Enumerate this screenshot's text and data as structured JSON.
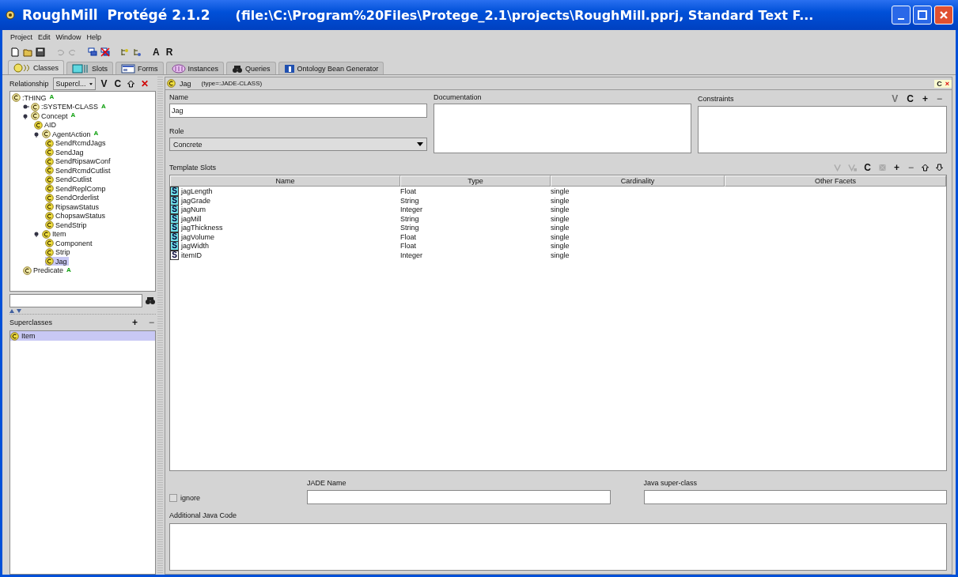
{
  "window": {
    "title": "RoughMill  Protégé 2.1.2",
    "subtitle": "(file:\\C:\\Program%20Files\\Protege_2.1\\projects\\RoughMill.pprj, Standard Text F..."
  },
  "menu": [
    "Project",
    "Edit",
    "Window",
    "Help"
  ],
  "toolbar_text": [
    "A",
    "R"
  ],
  "tabs": [
    {
      "label": "Classes",
      "selected": true
    },
    {
      "label": "Slots",
      "selected": false
    },
    {
      "label": "Forms",
      "selected": false
    },
    {
      "label": "Instances",
      "selected": false
    },
    {
      "label": "Queries",
      "selected": false
    },
    {
      "label": "Ontology Bean Generator",
      "selected": false
    }
  ],
  "relationship": {
    "label": "Relationship",
    "value": "Supercl...",
    "buttons": [
      "V",
      "C",
      "✕"
    ]
  },
  "tree": [
    {
      "label": ":THING",
      "badge": "A",
      "selected": false,
      "children": [
        {
          "label": ":SYSTEM-CLASS",
          "badge": "A",
          "selected": false,
          "expanded": false
        },
        {
          "label": "Concept",
          "badge": "A",
          "selected": false,
          "expanded": true,
          "children": [
            {
              "label": "AID",
              "selected": false
            },
            {
              "label": "AgentAction",
              "badge": "A",
              "selected": false,
              "expanded": true,
              "children": [
                {
                  "label": "SendRcmdJags",
                  "selected": false
                },
                {
                  "label": "SendJag",
                  "selected": false
                },
                {
                  "label": "SendRipsawConf",
                  "selected": false
                },
                {
                  "label": "SendRcmdCutlist",
                  "selected": false
                },
                {
                  "label": "SendCutlist",
                  "selected": false
                },
                {
                  "label": "SendReplComp",
                  "selected": false
                },
                {
                  "label": "SendOrderlist",
                  "selected": false
                },
                {
                  "label": "RipsawStatus",
                  "selected": false
                },
                {
                  "label": "ChopsawStatus",
                  "selected": false
                },
                {
                  "label": "SendStrip",
                  "selected": false
                }
              ]
            },
            {
              "label": "Item",
              "selected": false,
              "expanded": true,
              "children": [
                {
                  "label": "Component",
                  "selected": false
                },
                {
                  "label": "Strip",
                  "selected": false
                },
                {
                  "label": "Jag",
                  "selected": true
                }
              ]
            }
          ]
        },
        {
          "label": "Predicate",
          "badge": "A",
          "selected": false
        }
      ]
    }
  ],
  "superclasses": {
    "title": "Superclasses",
    "buttons": [
      "+",
      "−"
    ],
    "items": [
      {
        "label": "Item",
        "selected": true
      }
    ]
  },
  "header": {
    "class_name": "Jag",
    "type": "(type=:JADE-CLASS)",
    "buttons": [
      "C",
      "×"
    ]
  },
  "form": {
    "name_label": "Name",
    "name_value": "Jag",
    "role_label": "Role",
    "role_value": "Concrete",
    "documentation_label": "Documentation",
    "constraints_label": "Constraints",
    "constraint_buttons": [
      {
        "label": "V",
        "disabled": true
      },
      {
        "label": "C",
        "disabled": false
      },
      {
        "label": "+",
        "disabled": false
      },
      {
        "label": "−",
        "disabled": true
      }
    ]
  },
  "template_slots": {
    "title": "Template Slots",
    "buttons": [
      {
        "label": "C",
        "disabled": false
      },
      {
        "label": "+",
        "disabled": false
      },
      {
        "label": "−",
        "disabled": true
      }
    ],
    "columns": [
      "Name",
      "Type",
      "Cardinality",
      "Other Facets"
    ],
    "rows": [
      {
        "icon": "S",
        "name": "jagLength",
        "type": "Float",
        "cardinality": "single",
        "inherited": false
      },
      {
        "icon": "S",
        "name": "jagGrade",
        "type": "String",
        "cardinality": "single",
        "inherited": false
      },
      {
        "icon": "S",
        "name": "jagNum",
        "type": "Integer",
        "cardinality": "single",
        "inherited": false
      },
      {
        "icon": "S",
        "name": "jagMill",
        "type": "String",
        "cardinality": "single",
        "inherited": false
      },
      {
        "icon": "S",
        "name": "jagThickness",
        "type": "String",
        "cardinality": "single",
        "inherited": false
      },
      {
        "icon": "S",
        "name": "jagVolume",
        "type": "Float",
        "cardinality": "single",
        "inherited": false
      },
      {
        "icon": "S",
        "name": "jagWidth",
        "type": "Float",
        "cardinality": "single",
        "inherited": false
      },
      {
        "icon": "S",
        "name": "itemID",
        "type": "Integer",
        "cardinality": "single",
        "inherited": true
      }
    ]
  },
  "jade": {
    "ignore_label": "ignore",
    "ignore_checked": false,
    "jade_name_label": "JADE Name",
    "java_super_label": "Java super-class",
    "additional_code_label": "Additional Java Code"
  }
}
